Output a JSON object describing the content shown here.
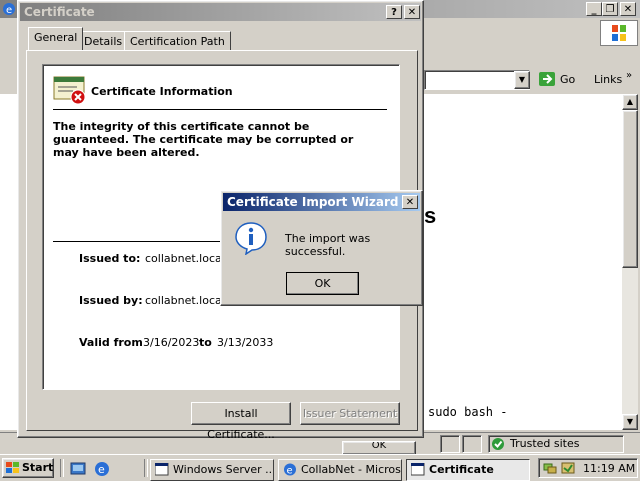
{
  "browser": {
    "address_go": "Go",
    "links": "Links",
    "status_zone": "Trusted sites",
    "behind_text_fragment": "s",
    "terminal_text": "sudo bash -"
  },
  "cert_dialog": {
    "title": "Certificate",
    "help_btn": "?",
    "close_btn": "✕",
    "tabs": [
      "General",
      "Details",
      "Certification Path"
    ],
    "info_heading": "Certificate Information",
    "warning": "The integrity of this certificate cannot be guaranteed. The certificate may be corrupted or may have been altered.",
    "issued_to_label": "Issued to:",
    "issued_to_value": "collabnet.local",
    "issued_by_label": "Issued by:",
    "issued_by_value": "collabnet.local",
    "valid_from_label": "Valid from",
    "valid_from_value": "3/16/2023",
    "valid_to_label": "to",
    "valid_to_value": "3/13/2033",
    "install_btn": "Install Certificate...",
    "issuer_btn": "Issuer Statement",
    "ok_btn": "OK"
  },
  "wizard_dialog": {
    "title": "Certificate Import Wizard",
    "message": "The import was successful.",
    "ok_btn": "OK"
  },
  "taskbar": {
    "start": "Start",
    "tasks": [
      {
        "label": "Windows Server ...",
        "active": false
      },
      {
        "label": "CollabNet - Micros...",
        "active": false
      },
      {
        "label": "Certificate",
        "active": true
      }
    ],
    "clock": "11:19 AM"
  },
  "colors": {
    "titlebar_active": "#0a246a",
    "titlebar_gradient_end": "#a6caf0",
    "face": "#d4d0c8",
    "error_red": "#d01010",
    "info_blue": "#1f5fbf"
  },
  "icons": [
    "ie-icon",
    "certificate-error-icon",
    "info-icon",
    "go-arrow-icon",
    "windows-logo-icon",
    "trusted-sites-icon"
  ]
}
